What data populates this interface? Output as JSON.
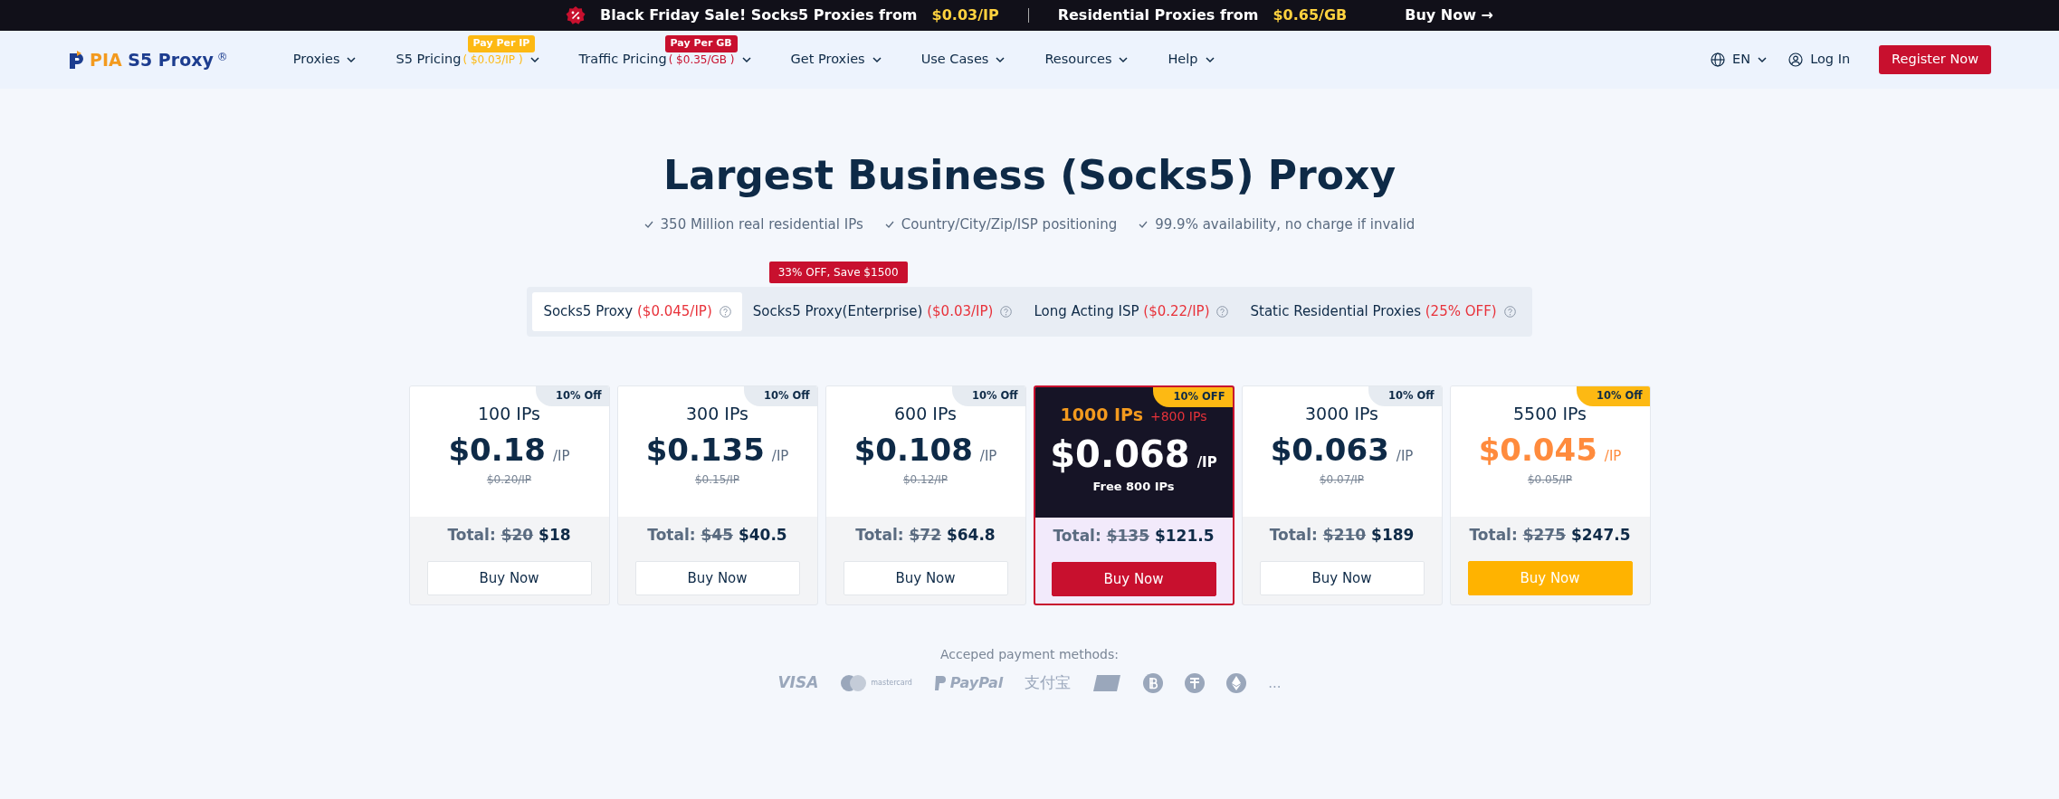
{
  "promo_bar": {
    "headline": "Black Friday Sale! Socks5 Proxies from",
    "headline_price": "$0.03/IP",
    "second": "Residential Proxies from",
    "second_price": "$0.65/GB",
    "cta": "Buy Now",
    "cta_arrow": "→"
  },
  "brand": {
    "name": "PIA S5 Proxy",
    "mark": "®"
  },
  "nav": [
    {
      "label": "Proxies"
    },
    {
      "label": "S5 Pricing",
      "badge": "Pay Per IP",
      "color": "#fdb913",
      "sub": "( $0.03/IP )"
    },
    {
      "label": "Traffic Pricing",
      "badge": "Pay Per GB",
      "color": "#c8102e",
      "sub": "( $0.35/GB )"
    },
    {
      "label": "Get Proxies"
    },
    {
      "label": "Use Cases"
    },
    {
      "label": "Resources"
    },
    {
      "label": "Help"
    }
  ],
  "language": "EN",
  "login": "Log In",
  "register": "Register Now",
  "title": "Largest Business (Socks5) Proxy",
  "features": [
    "350 Million real residential IPs",
    "Country/City/Zip/ISP positioning",
    "99.9% availability, no charge if invalid"
  ],
  "tabs": [
    {
      "label": "Socks5 Proxy",
      "price": "($0.045/IP)",
      "selected": true
    },
    {
      "label": "Socks5 Proxy(Enterprise)",
      "price": "($0.03/IP)",
      "selected": false,
      "tag": "33% OFF, Save $1500"
    },
    {
      "label": "Long Acting ISP",
      "price": "($0.22/IP)",
      "selected": false
    },
    {
      "label": "Static Residential Proxies",
      "price": "(25% OFF)",
      "selected": false
    }
  ],
  "plans": [
    {
      "kind": "normal",
      "badge": "10% Off",
      "ips": "100 IPs",
      "price": "$0.18",
      "unit": "/IP",
      "old_price": "$0.20/IP",
      "total_label": "Total:",
      "total_old": "$20",
      "total": "$18",
      "button": "Buy Now"
    },
    {
      "kind": "normal",
      "badge": "10% Off",
      "ips": "300 IPs",
      "price": "$0.135",
      "unit": "/IP",
      "old_price": "$0.15/IP",
      "total_label": "Total:",
      "total_old": "$45",
      "total": "$40.5",
      "button": "Buy Now"
    },
    {
      "kind": "normal",
      "badge": "10% Off",
      "ips": "600 IPs",
      "price": "$0.108",
      "unit": "/IP",
      "old_price": "$0.12/IP",
      "total_label": "Total:",
      "total_old": "$72",
      "total": "$64.8",
      "button": "Buy Now"
    },
    {
      "kind": "featured",
      "badge": "10% OFF",
      "ips": "1000 IPs",
      "bonus": "+800 IPs",
      "price": "$0.068",
      "unit": "/IP",
      "note": "Free 800 IPs",
      "total_label": "Total:",
      "total_old": "$135",
      "total": "$121.5",
      "button": "Buy Now"
    },
    {
      "kind": "normal",
      "badge": "10% Off",
      "ips": "3000 IPs",
      "price": "$0.063",
      "unit": "/IP",
      "old_price": "$0.07/IP",
      "total_label": "Total:",
      "total_old": "$210",
      "total": "$189",
      "button": "Buy Now"
    },
    {
      "kind": "best",
      "badge": "10% Off",
      "ips": "5500 IPs",
      "price": "$0.045",
      "unit": "/IP",
      "old_price": "$0.05/IP",
      "total_label": "Total:",
      "total_old": "$275",
      "total": "$247.5",
      "button": "Buy Now"
    }
  ],
  "payment": {
    "label": "Acceped payment methods:",
    "methods": [
      {
        "kind": "visa",
        "text": "VISA"
      },
      {
        "kind": "mastercard",
        "text": "mastercard"
      },
      {
        "kind": "paypal",
        "text": "PayPal"
      },
      {
        "kind": "alipay",
        "text": "支付宝"
      },
      {
        "kind": "unionpay"
      },
      {
        "kind": "bitcoin"
      },
      {
        "kind": "tether"
      },
      {
        "kind": "ethereum"
      },
      {
        "kind": "more",
        "text": "..."
      }
    ]
  }
}
